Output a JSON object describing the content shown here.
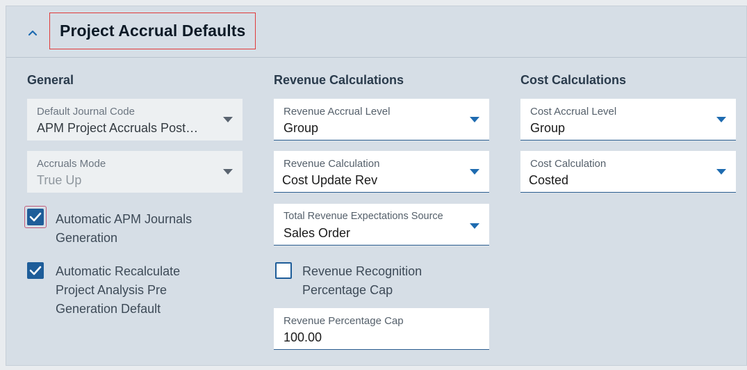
{
  "section": {
    "title": "Project Accrual Defaults",
    "collapse_icon": "chevron-up-icon"
  },
  "general": {
    "heading": "General",
    "journal_code": {
      "label": "Default Journal Code",
      "value": "APM Project Accruals Post…"
    },
    "accruals_mode": {
      "label": "Accruals Mode",
      "value": "True Up"
    },
    "auto_apm_journals": {
      "label_line1": "Automatic APM Journals",
      "label_line2": "Generation",
      "checked": true
    },
    "auto_recalc": {
      "label_line1": "Automatic Recalculate",
      "label_line2": "Project Analysis Pre",
      "label_line3": "Generation Default",
      "checked": true
    }
  },
  "revenue": {
    "heading": "Revenue Calculations",
    "accrual_level": {
      "label": "Revenue Accrual Level",
      "value": "Group"
    },
    "calculation": {
      "label": "Revenue Calculation",
      "value": "Cost Update Rev"
    },
    "expectations_source": {
      "label": "Total Revenue Expectations Source",
      "value": "Sales Order"
    },
    "recognition_cap": {
      "label_line1": "Revenue Recognition",
      "label_line2": "Percentage Cap",
      "checked": false
    },
    "percentage_cap": {
      "label": "Revenue Percentage Cap",
      "value": "100.00"
    }
  },
  "cost": {
    "heading": "Cost Calculations",
    "accrual_level": {
      "label": "Cost Accrual Level",
      "value": "Group"
    },
    "calculation": {
      "label": "Cost Calculation",
      "value": "Costed"
    }
  },
  "colors": {
    "accent": "#1e6bb0",
    "checkbox": "#1e5d99",
    "highlight": "#e03a3a",
    "panel": "#d6dee6"
  }
}
